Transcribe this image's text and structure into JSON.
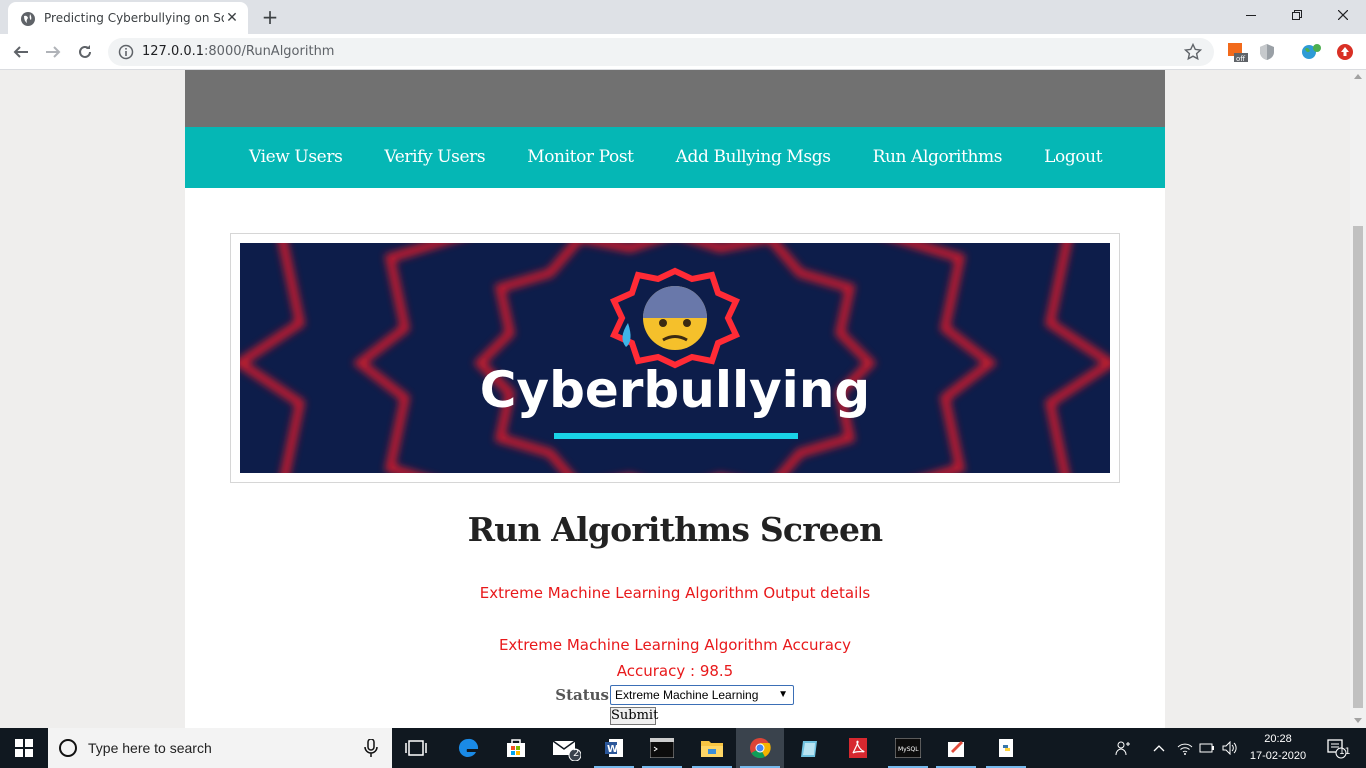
{
  "browser": {
    "tab_title": "Predicting Cyberbullying on Social",
    "url_host": "127.0.0.1",
    "url_rest": ":8000/RunAlgorithm"
  },
  "nav": {
    "items": [
      {
        "label": "View Users"
      },
      {
        "label": "Verify Users"
      },
      {
        "label": "Monitor Post"
      },
      {
        "label": "Add Bullying Msgs"
      },
      {
        "label": "Run Algorithms"
      },
      {
        "label": "Logout"
      }
    ]
  },
  "banner": {
    "text": "Cyberbullying",
    "colors": {
      "background": "#0d1d4a",
      "ring": "#e21f2a",
      "text": "#ffffff",
      "underline": "#19d3e6"
    }
  },
  "main": {
    "heading": "Run Algorithms Screen",
    "output_title": "Extreme Machine Learning Algorithm Output details",
    "accuracy_title": "Extreme Machine Learning Algorithm Accuracy",
    "accuracy_value": "Accuracy : 98.5",
    "status_label": "Status",
    "status_selected": "Extreme Machine Learning",
    "submit_label": "Submit"
  },
  "colors": {
    "menu_bg": "#05b7b5",
    "header_band": "#717171",
    "output_text": "#e8191b"
  },
  "taskbar": {
    "search_placeholder": "Type here to search",
    "mail_badge": "2",
    "time": "20:28",
    "date": "17-02-2020",
    "notification_count": "11"
  }
}
